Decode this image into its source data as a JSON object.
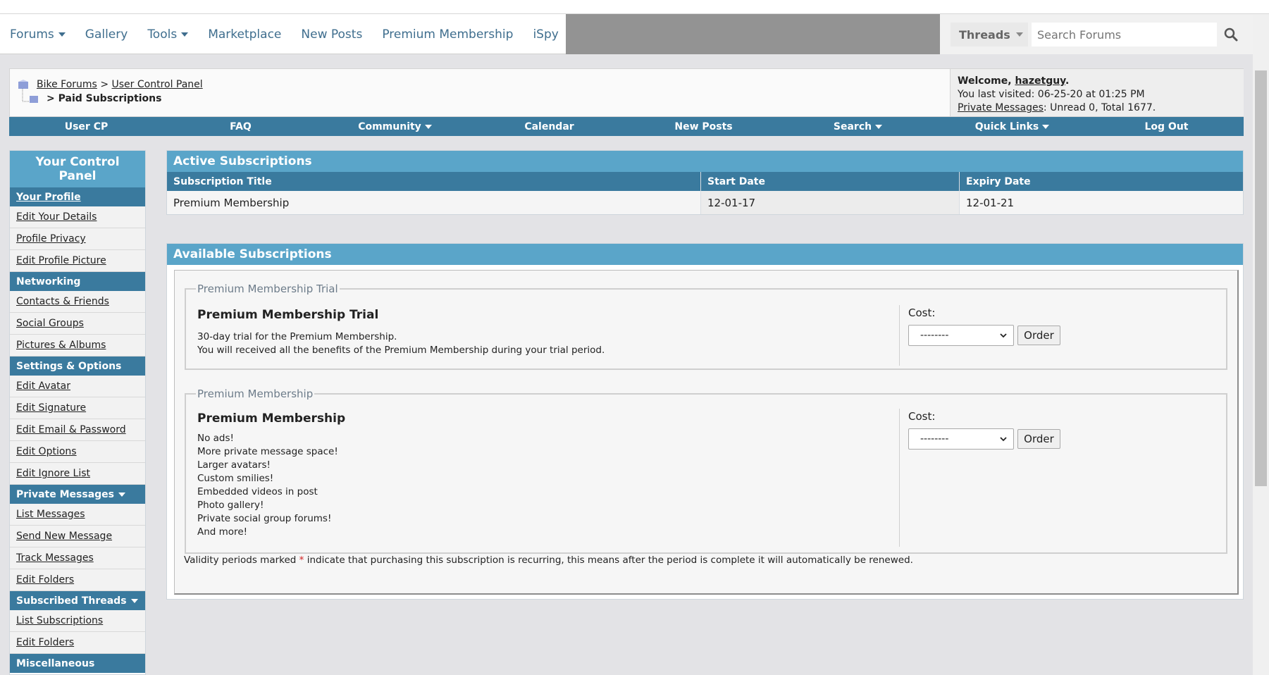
{
  "nav": {
    "items": [
      {
        "label": "Forums",
        "dropdown": true
      },
      {
        "label": "Gallery",
        "dropdown": false
      },
      {
        "label": "Tools",
        "dropdown": true
      },
      {
        "label": "Marketplace",
        "dropdown": false
      },
      {
        "label": "New Posts",
        "dropdown": false
      },
      {
        "label": "Premium Membership",
        "dropdown": false
      },
      {
        "label": "iSpy",
        "dropdown": false
      }
    ],
    "search_scope": "Threads",
    "search_placeholder": "Search Forums"
  },
  "breadcrumb": {
    "root": "Bike Forums",
    "sep": ">",
    "parent": "User Control Panel",
    "current": "Paid Subscriptions"
  },
  "welcome": {
    "prefix": "Welcome,",
    "username": "hazetguy",
    "period": ".",
    "last_visited": "You last visited: 06-25-20 at 01:25 PM",
    "pm_link": "Private Messages",
    "pm_stats": ": Unread 0, Total 1677."
  },
  "bluebar": {
    "items": [
      {
        "label": "User CP",
        "dropdown": false
      },
      {
        "label": "FAQ",
        "dropdown": false
      },
      {
        "label": "Community",
        "dropdown": true
      },
      {
        "label": "Calendar",
        "dropdown": false
      },
      {
        "label": "New Posts",
        "dropdown": false
      },
      {
        "label": "Search",
        "dropdown": true
      },
      {
        "label": "Quick Links",
        "dropdown": true
      },
      {
        "label": "Log Out",
        "dropdown": false
      }
    ]
  },
  "sidebar": {
    "title": "Your Control Panel",
    "sections": [
      {
        "heading": "Your Profile",
        "links": [
          "Edit Your Details",
          "Profile Privacy",
          "Edit Profile Picture"
        ]
      },
      {
        "heading": "Networking",
        "links": [
          "Contacts & Friends",
          "Social Groups",
          "Pictures & Albums"
        ]
      },
      {
        "heading": "Settings & Options",
        "links": [
          "Edit Avatar",
          "Edit Signature",
          "Edit Email & Password",
          "Edit Options",
          "Edit Ignore List"
        ]
      },
      {
        "heading": "Private Messages",
        "links": [
          "List Messages",
          "Send New Message",
          "Track Messages",
          "Edit Folders"
        ]
      },
      {
        "heading": "Subscribed Threads",
        "links": [
          "List Subscriptions",
          "Edit Folders"
        ]
      },
      {
        "heading": "Miscellaneous",
        "links": []
      }
    ]
  },
  "active": {
    "title": "Active Subscriptions",
    "columns": [
      "Subscription Title",
      "Start Date",
      "Expiry Date"
    ],
    "rows": [
      [
        "Premium Membership",
        "12-01-17",
        "12-01-21"
      ]
    ]
  },
  "available": {
    "title": "Available Subscriptions",
    "subs": [
      {
        "legend": "Premium Membership Trial",
        "title": "Premium Membership Trial",
        "desc": [
          "30-day trial for the Premium Membership.",
          "You will received all the benefits of the Premium Membership during your trial period."
        ],
        "cost_label": "Cost:",
        "cost_value": "--------",
        "order_label": "Order"
      },
      {
        "legend": "Premium Membership",
        "title": "Premium Membership",
        "desc": [
          "No ads!",
          "More private message space!",
          "Larger avatars!",
          "Custom smilies!",
          "Embedded videos in post",
          "Photo gallery!",
          "Private social group forums!",
          "And more!"
        ],
        "cost_label": "Cost:",
        "cost_value": "--------",
        "order_label": "Order"
      }
    ],
    "note_before": "Validity periods marked",
    "note_star": "*",
    "note_after": "indicate that purchasing this subscription is recurring, this means after the period is complete it will automatically be renewed."
  }
}
